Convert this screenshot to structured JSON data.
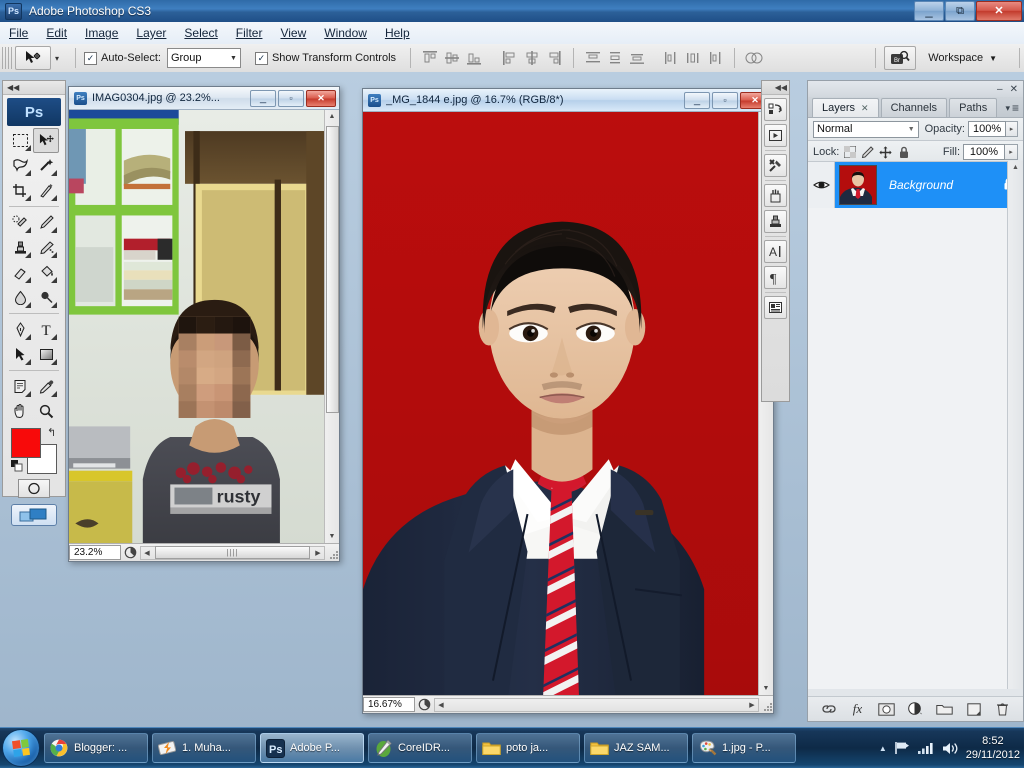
{
  "window": {
    "app_title": "Adobe Photoshop CS3",
    "app_badge": "Ps",
    "minimize_label": "–",
    "restore_label": "❐",
    "close_label": "✕"
  },
  "menu": {
    "items": [
      "File",
      "Edit",
      "Image",
      "Layer",
      "Select",
      "Filter",
      "View",
      "Window",
      "Help"
    ]
  },
  "options_bar": {
    "tool_caret": "▾",
    "auto_select_checked": "✓",
    "auto_select_label": "Auto-Select:",
    "auto_select_value": "Group",
    "auto_select_arrow": "▼",
    "show_transform_checked": "✓",
    "show_transform_label": "Show Transform Controls",
    "bridge_label": "Br",
    "workspace_label": "Workspace",
    "workspace_arrow": "▼",
    "align_icons": [
      "align-top-edges-icon",
      "align-vertical-centers-icon",
      "align-bottom-edges-icon",
      "align-left-edges-icon",
      "align-horizontal-centers-icon",
      "align-right-edges-icon",
      "distribute-top-edges-icon",
      "distribute-vertical-centers-icon",
      "distribute-bottom-edges-icon",
      "distribute-left-edges-icon",
      "distribute-horizontal-centers-icon",
      "distribute-right-edges-icon",
      "auto-align-layers-icon"
    ]
  },
  "toolbox": {
    "collapse_label": "◀◀",
    "logo": "Ps",
    "tools": [
      "marquee-tool",
      "move-tool",
      "lasso-tool",
      "magic-wand-tool",
      "crop-tool",
      "eyedropper-tool",
      "healing-brush-tool",
      "brush-tool",
      "clone-stamp-tool",
      "history-brush-tool",
      "eraser-tool",
      "paint-bucket-tool",
      "blur-tool",
      "dodge-tool",
      "pen-tool",
      "type-tool",
      "path-selection-tool",
      "rectangle-tool",
      "notes-tool",
      "eyedropper-alt-tool",
      "hand-tool",
      "zoom-tool"
    ],
    "selected_tool": "move-tool",
    "foreground_color": "#f80a0a",
    "background_color": "#ffffff",
    "swap_icon": "↰",
    "quick_mask_label": "quick-mask-icon",
    "screen_mode_label": "screen-mode-icon"
  },
  "documents": [
    {
      "title": "IMAG0304.jpg @ 23.2%...",
      "icon": "Ps",
      "zoom": "23.2%",
      "active": false,
      "minimize": "–",
      "maximize": "▫",
      "close": "✕",
      "scroll_left_arrow": "◀",
      "scroll_right_arrow": "▶",
      "scroll_up_arrow": "▲",
      "scroll_down_arrow": "▼",
      "thumb_grip": "‖‖"
    },
    {
      "title": "_MG_1844 e.jpg @ 16.7% (RGB/8*)",
      "icon": "Ps",
      "zoom": "16.67%",
      "active": true,
      "minimize": "–",
      "maximize": "▫",
      "close": "✕",
      "scroll_left_arrow": "◀",
      "scroll_right_arrow": "▶",
      "scroll_up_arrow": "▲",
      "scroll_down_arrow": "▼"
    }
  ],
  "dock_strip": {
    "collapse_label": "◀◀",
    "icons": [
      "history-panel-icon",
      "actions-panel-icon",
      "tool-presets-icon",
      "brushes-panel-icon",
      "clone-source-panel-icon",
      "character-panel-icon",
      "paragraph-panel-icon",
      "layer-comps-panel-icon"
    ]
  },
  "layers_panel": {
    "minimize": "–",
    "close": "✕",
    "menu_arrow": "▾",
    "menu_lines": "≡",
    "tabs": [
      {
        "label": "Layers",
        "close": "✕",
        "active": true
      },
      {
        "label": "Channels",
        "active": false
      },
      {
        "label": "Paths",
        "active": false
      }
    ],
    "blend_mode": "Normal",
    "blend_arrow": "▼",
    "opacity_label": "Opacity:",
    "opacity_value": "100%",
    "spin_arrow": "▸",
    "lock_label": "Lock:",
    "lock_icons": [
      "lock-transparent-pixels-icon",
      "lock-image-pixels-icon",
      "lock-position-icon",
      "lock-all-icon"
    ],
    "fill_label": "Fill:",
    "fill_value": "100%",
    "layer": {
      "name": "Background",
      "eye_icon": "eye-visibility-icon",
      "lock_icon": "lock-icon",
      "selected_color": "#1e90f7"
    },
    "scroll_up_arrow": "▲",
    "bottom_icons": [
      "link-layers-icon",
      "layer-style-icon",
      "layer-mask-icon",
      "adjustment-layer-icon",
      "new-group-icon",
      "new-layer-icon",
      "delete-layer-icon"
    ],
    "fx_label": "fx"
  },
  "taskbar": {
    "start_label": "start-orb",
    "items": [
      {
        "label": "Blogger: ...",
        "icon": "chrome-icon",
        "active": false
      },
      {
        "label": "1. Muha...",
        "icon": "winamp-icon",
        "active": false
      },
      {
        "label": "Adobe P...",
        "icon": "photoshop-icon",
        "active": true
      },
      {
        "label": "CoreIDR...",
        "icon": "coreldraw-icon",
        "active": false
      },
      {
        "label": "poto ja...",
        "icon": "folder-icon",
        "active": false
      },
      {
        "label": "JAZ SAM...",
        "icon": "folder-icon",
        "active": false
      },
      {
        "label": "1.jpg - P...",
        "icon": "paint-icon",
        "active": false
      }
    ],
    "tray": {
      "show_hidden_arrow": "▲",
      "icons": [
        "flag-action-center-icon",
        "network-signal-icon",
        "volume-icon"
      ],
      "time": "8:52",
      "date": "29/11/2012"
    }
  },
  "colors": {
    "photo_red_background": "#b40d0d",
    "suit_navy": "#1f2a40",
    "tie_red": "#d3182c",
    "accent_blue": "#1e90f7"
  }
}
